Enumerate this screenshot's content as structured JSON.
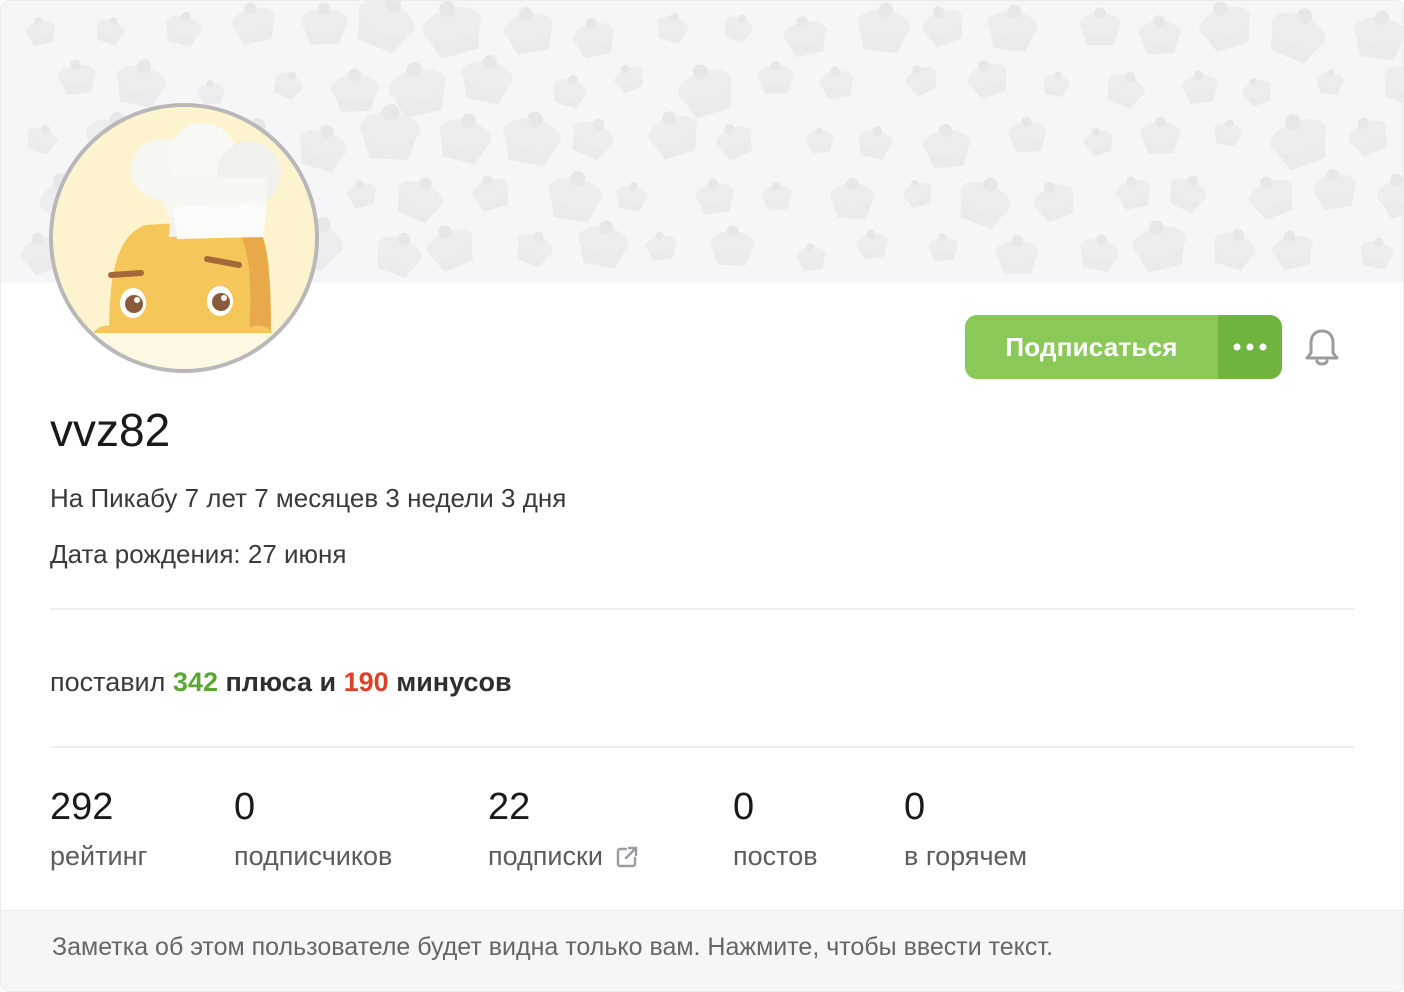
{
  "profile": {
    "username": "vvz82",
    "on_site": "На Пикабу 7 лет 7 месяцев 3 недели 3 дня",
    "birthday": "Дата рождения: 27 июня"
  },
  "actions": {
    "subscribe_label": "Подписаться"
  },
  "votes": {
    "prefix": "поставил",
    "plus_count": "342",
    "plus_word": "плюса и",
    "minus_count": "190",
    "minus_word": "минусов"
  },
  "stats": [
    {
      "value": "292",
      "label": "рейтинг"
    },
    {
      "value": "0",
      "label": "подписчиков"
    },
    {
      "value": "22",
      "label": "подписки"
    },
    {
      "value": "0",
      "label": "постов"
    },
    {
      "value": "0",
      "label": "в горячем"
    }
  ],
  "note": {
    "placeholder": "Заметка об этом пользователе будет видна только вам. Нажмите, чтобы ввести текст."
  },
  "colors": {
    "accent_green": "#8ac858",
    "accent_green_dark": "#6fb43f",
    "plus_green": "#5aa832",
    "minus_red": "#e0402a"
  },
  "icons": [
    "more-dots-icon",
    "bell-icon",
    "external-link-icon"
  ]
}
